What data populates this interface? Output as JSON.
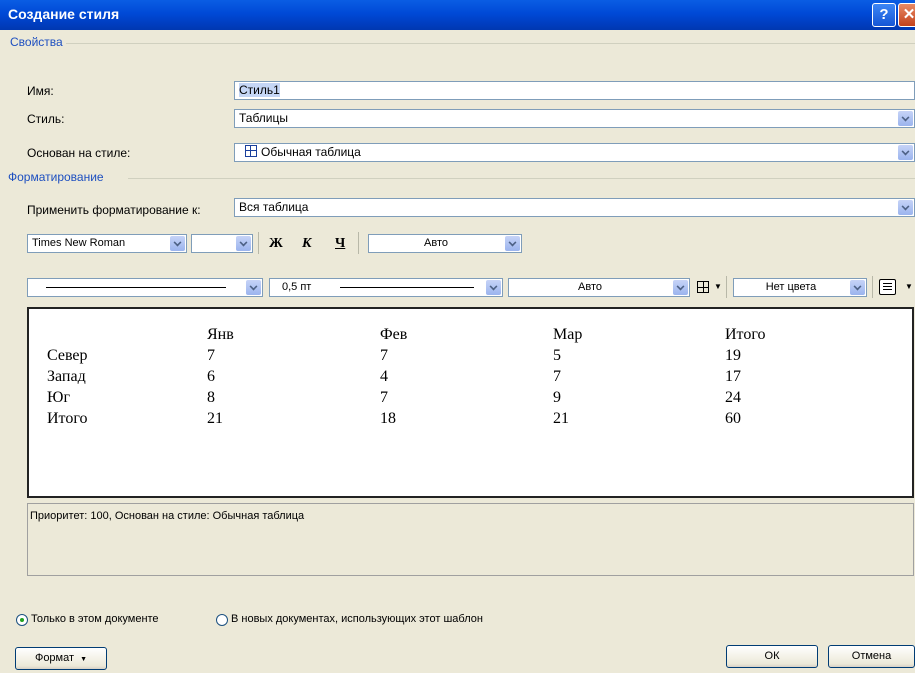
{
  "window": {
    "title": "Создание стиля",
    "help_label": "?",
    "close_label": "✕"
  },
  "properties": {
    "section_title": "Свойства",
    "name_label": "Имя:",
    "name_value": "Стиль1",
    "style_label": "Стиль:",
    "style_value": "Таблицы",
    "based_on_label": "Основан на стиле:",
    "based_on_value": "Обычная таблица",
    "based_on_icon": "table-icon"
  },
  "formatting": {
    "section_title": "Форматирование",
    "apply_to_label": "Применить форматирование к:",
    "apply_to_value": "Вся таблица",
    "font_name": "Times New Roman",
    "font_size": "",
    "bold_label": "Ж",
    "italic_label": "К",
    "underline_label": "Ч",
    "font_color": "Авто",
    "line_width": "0,5 пт",
    "border_color": "Авто",
    "shading": "Нет цвета"
  },
  "preview": {
    "headers": [
      "",
      "Янв",
      "Фев",
      "Мар",
      "Итого"
    ],
    "rows": [
      [
        "Север",
        "7",
        "7",
        "5",
        "19"
      ],
      [
        "Запад",
        "6",
        "4",
        "7",
        "17"
      ],
      [
        "Юг",
        "8",
        "7",
        "9",
        "24"
      ],
      [
        "Итого",
        "21",
        "18",
        "21",
        "60"
      ]
    ]
  },
  "description": "Приоритет: 100, Основан на стиле: Обычная таблица",
  "scope": {
    "option_this_doc": "Только в этом документе",
    "option_template": "В новых документах, использующих этот шаблон",
    "selected": "this_doc"
  },
  "buttons": {
    "format_label": "Формат",
    "ok_label": "ОК",
    "cancel_label": "Отмена"
  }
}
